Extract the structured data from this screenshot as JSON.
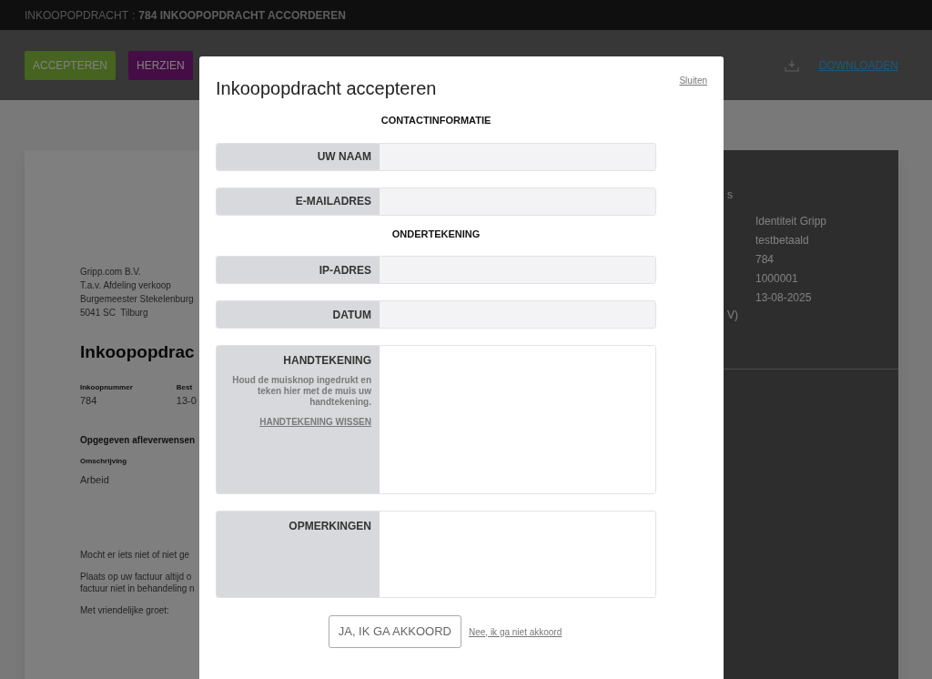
{
  "header": {
    "section": "INKOOPOPDRACHT",
    "separator": ":",
    "title": "784 INKOOPOPDRACHT ACCORDEREN"
  },
  "toolbar": {
    "buttons": [
      {
        "label": "ACCEPTEREN",
        "kind": "accept"
      },
      {
        "label": "HERZIEN",
        "kind": "revise"
      }
    ],
    "download": "DOWNLOADEN"
  },
  "document": {
    "address": [
      "Gripp.com B.V.",
      "T.a.v. Afdeling verkoop",
      "Burgemeester Stekelenburg",
      "5041 SC  Tilburg"
    ],
    "heading": "Inkoopopdrac",
    "fields": [
      {
        "label": "Inkoopnummer",
        "value": "784"
      },
      {
        "label": "Best",
        "value": "13-0"
      }
    ],
    "section": "Opgegeven afleverwensen",
    "column": "Omschrijving",
    "item": "Arbeid",
    "paragraphs": [
      "Mocht er iets niet of niet ge",
      "Plaats op uw factuur altijd o\nfactuur niet in behandeling n",
      "Met vriendelijke groet:"
    ]
  },
  "side_panel": {
    "heading": "s",
    "values": [
      "Identiteit Gripp",
      "testbetaald",
      "784",
      "1000001",
      "13-08-2025"
    ],
    "note": "V)"
  },
  "dialog": {
    "title": "Inkoopopdracht accepteren",
    "close": "Sluiten",
    "sections": [
      {
        "heading": "CONTACTINFORMATIE",
        "fields": [
          {
            "label": "UW NAAM",
            "kind": "input"
          },
          {
            "label": "E-MAILADRES",
            "kind": "input"
          }
        ]
      },
      {
        "heading": "ONDERTEKENING",
        "fields": [
          {
            "label": "IP-ADRES",
            "kind": "input"
          },
          {
            "label": "DATUM",
            "kind": "input"
          },
          {
            "label": "HANDTEKENING",
            "kind": "signature",
            "hint": "Houd de muisknop ingedrukt en teken hier met de muis uw handtekening.",
            "link": "HANDTEKENING WISSEN"
          },
          {
            "label": "OPMERKINGEN",
            "kind": "textarea"
          }
        ]
      }
    ],
    "accept": "JA, IK GA AKKOORD",
    "decline": "Nee, ik ga niet akkoord"
  }
}
